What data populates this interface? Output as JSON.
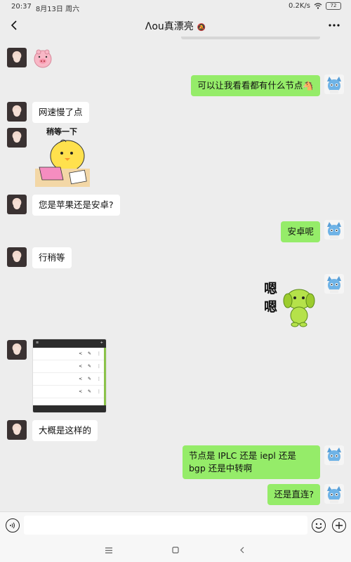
{
  "status": {
    "time": "20:37",
    "date": "8月13日 周六",
    "speed": "0.2K/s",
    "battery": "72"
  },
  "header": {
    "title": "Λou真漂亮",
    "back_icon": "chevron-left-icon",
    "more_icon": "more-dots-icon",
    "mute_icon": "mute-bell-icon"
  },
  "messages": [
    {
      "from": "them",
      "type": "sticker",
      "sticker": "pink-pig-face"
    },
    {
      "from": "me",
      "type": "text",
      "text": "可以让我看看都有什么节点🐴"
    },
    {
      "from": "them",
      "type": "text",
      "text": "网速慢了点"
    },
    {
      "from": "them",
      "type": "sticker",
      "sticker": "yellow-chick-laptop",
      "caption": "稍等一下"
    },
    {
      "from": "them",
      "type": "text",
      "text": "您是苹果还是安卓?"
    },
    {
      "from": "me",
      "type": "text",
      "text": "安卓呢"
    },
    {
      "from": "them",
      "type": "text",
      "text": "行稍等"
    },
    {
      "from": "me",
      "type": "sticker",
      "sticker": "green-dog-nod",
      "caption": "嗯嗯"
    },
    {
      "from": "them",
      "type": "image",
      "image": "subscription-list-screenshot"
    },
    {
      "from": "them",
      "type": "text",
      "text": "大概是这样的"
    },
    {
      "from": "me",
      "type": "text",
      "text": "节点是 IPLC 还是 iepl 还是 bgp 还是中转啊"
    },
    {
      "from": "me",
      "type": "text",
      "text": "还是直连?"
    }
  ],
  "input": {
    "voice_icon": "voice-icon",
    "emoji_icon": "emoji-icon",
    "plus_icon": "plus-icon",
    "value": ""
  },
  "nav": {
    "menu_icon": "menu-icon",
    "home_icon": "home-icon",
    "back_icon": "back-triangle-icon"
  },
  "colors": {
    "out_bubble": "#95ec69",
    "in_bubble": "#ffffff",
    "background": "#ededed"
  }
}
